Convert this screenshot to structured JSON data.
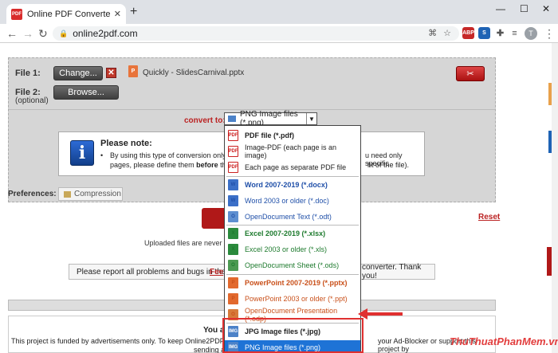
{
  "browser": {
    "tab_title": "Online PDF Converter - Merge, c",
    "favicon_text": "PDF",
    "url": "online2pdf.com",
    "avatar_letter": "T",
    "ext_adblock": "ABP"
  },
  "form": {
    "file1_label": "File 1:",
    "change_button": "Change...",
    "file_name": "Quickly - SlidesCarnival.pptx",
    "file2_label": "File 2:",
    "file2_sub": "(optional)",
    "browse_button": "Browse...",
    "convert_to_label": "convert to:",
    "selected_format": "PNG Image files (*.png)"
  },
  "note": {
    "title": "Please note:",
    "line1_start": "By using this type of conversion only a",
    "line1_end": "u need only specific",
    "line2_start": "pages, please define them ",
    "line2_bold": "before",
    "line2_mid": " the c",
    "line2_end": "ht of the file)."
  },
  "prefs": {
    "label": "Preferences:",
    "compression": "Compression"
  },
  "reset": "Reset",
  "uploaded_text": "Uploaded files are never save",
  "report": {
    "left": "Please report all problems and bugs in the",
    "link": "Fee",
    "right": "converter. Thank you!"
  },
  "ad": {
    "you": "You a",
    "line": "This project is funded by advertisements only. To keep Online2PDF",
    "right": "your Ad-Blocker or support this project by",
    "send": "sending a"
  },
  "dropdown": {
    "items": [
      {
        "label": "PDF file (*.pdf)",
        "icon": "PDF",
        "header": true
      },
      {
        "label": "Image-PDF (each page is an image)",
        "icon": "PDF"
      },
      {
        "label": "Each page as separate PDF file",
        "icon": "PDF"
      },
      {
        "label": "Word 2007-2019 (*.docx)",
        "icon": "W",
        "header": true
      },
      {
        "label": "Word 2003 or older (*.doc)",
        "icon": "W"
      },
      {
        "label": "OpenDocument Text (*.odt)",
        "icon": "O"
      },
      {
        "label": "Excel 2007-2019 (*.xlsx)",
        "icon": "X",
        "header": true
      },
      {
        "label": "Excel 2003 or older (*.xls)",
        "icon": "X"
      },
      {
        "label": "OpenDocument Sheet (*.ods)",
        "icon": "O"
      },
      {
        "label": "PowerPoint 2007-2019 (*.pptx)",
        "icon": "P",
        "header": true
      },
      {
        "label": "PowerPoint 2003 or older (*.ppt)",
        "icon": "P"
      },
      {
        "label": "OpenDocument Presentation (*.odp)",
        "icon": "O"
      },
      {
        "label": "JPG Image files (*.jpg)",
        "icon": "IMG",
        "header": true
      },
      {
        "label": "PNG Image files (*.png)",
        "icon": "IMG",
        "selected": true
      }
    ]
  },
  "watermark": "ThuThuatPhanMem.vn"
}
